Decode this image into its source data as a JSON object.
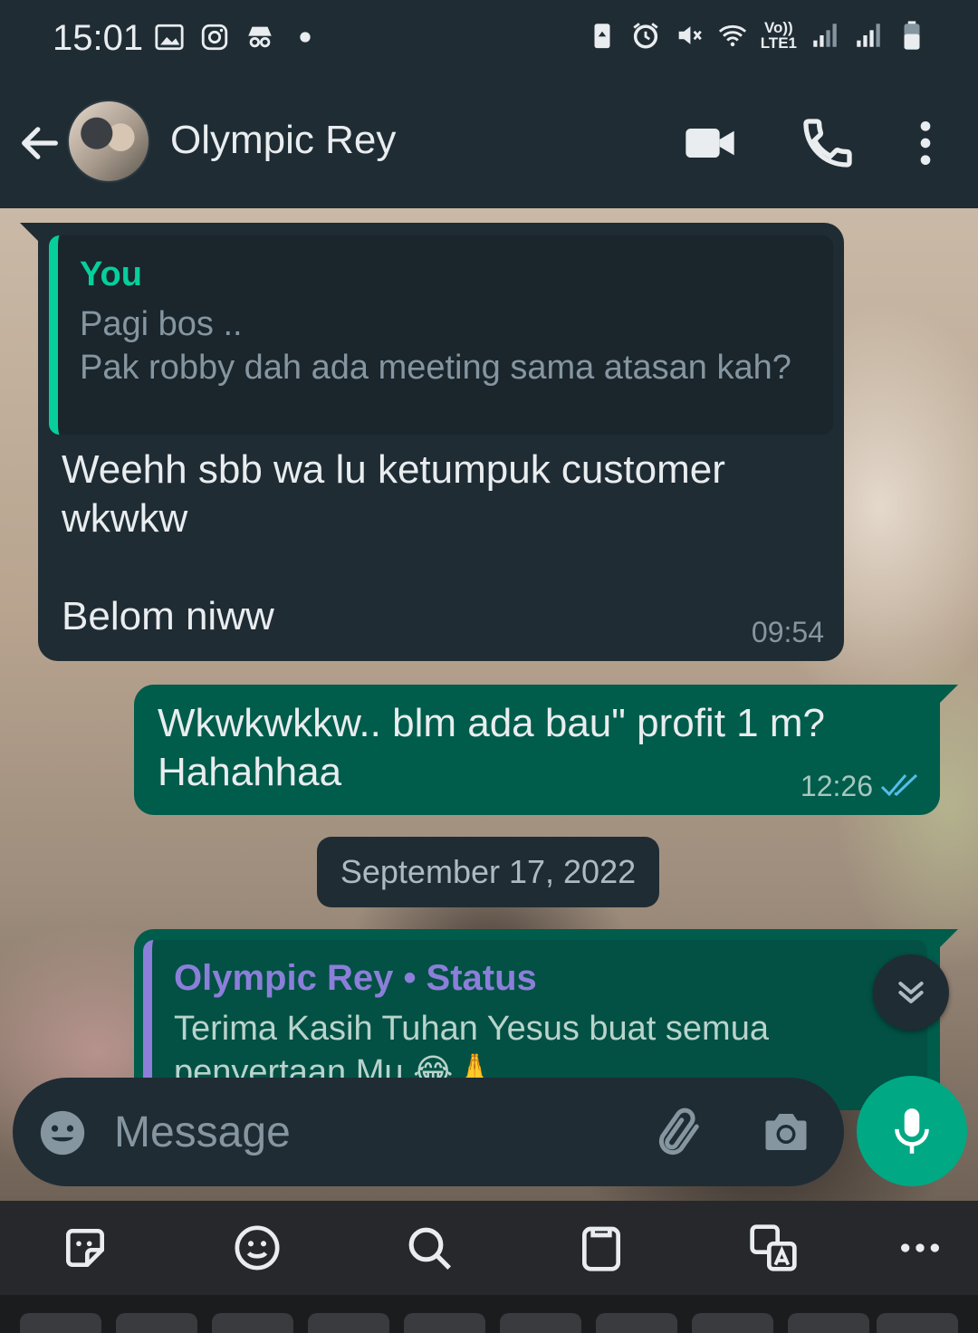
{
  "status_bar": {
    "time": "15:01",
    "network_label": "Vo))\nLTE1",
    "icons_left": [
      "gallery-icon",
      "instagram-icon",
      "incognito-icon",
      "dot-icon"
    ],
    "icons_right": [
      "battery-saver-icon",
      "alarm-icon",
      "mute-icon",
      "wifi-icon",
      "volte-icon",
      "signal-icon",
      "signal-icon",
      "battery-icon"
    ]
  },
  "header": {
    "contact_name": "Olympic Rey",
    "icons": [
      "back-arrow-icon",
      "avatar",
      "video-call-icon",
      "phone-icon",
      "more-vert-icon"
    ]
  },
  "messages": [
    {
      "direction": "incoming",
      "quote": {
        "author": "You",
        "text": "Pagi bos ..\nPak robby dah ada meeting sama atasan kah?"
      },
      "text": "Weehh sbb wa lu ketumpuk customer wkwkw\n\nBelom niww",
      "time": "09:54"
    },
    {
      "direction": "outgoing",
      "text": "Wkwkwkkw.. blm ada bau\" profit 1 m? Hahahhaa",
      "time": "12:26",
      "read": true
    }
  ],
  "date_chip": "September 17, 2022",
  "status_reply": {
    "author": "Olympic Rey • Status",
    "text": "Terima Kasih Tuhan Yesus buat semua\npenyertaan Mu 😂🙏"
  },
  "composer": {
    "placeholder": "Message"
  },
  "colors": {
    "header_bg": "#1f2c34",
    "incoming_bubble": "#1f2c34",
    "outgoing_bubble": "#005c4b",
    "accent_green": "#00a884",
    "quote_you": "#06cf9c",
    "quote_status": "#8b7fd9",
    "read_ticks": "#53bdeb"
  },
  "keyboard_toolbar": {
    "icons": [
      "sticker-icon",
      "emoji-icon",
      "search-icon",
      "clipboard-icon",
      "translate-icon",
      "more-horiz-icon"
    ]
  }
}
